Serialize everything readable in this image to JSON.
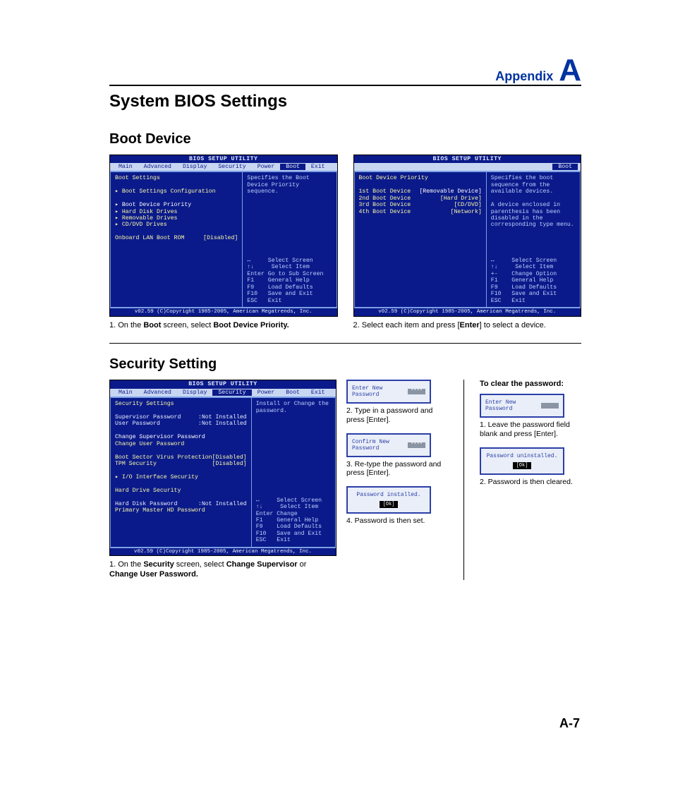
{
  "header": {
    "appendix": "Appendix",
    "letter": "A"
  },
  "page_title": "System BIOS Settings",
  "section_boot": "Boot Device",
  "section_security": "Security Setting",
  "page_number": "A-7",
  "bios_common": {
    "title": "BIOS SETUP UTILITY",
    "footer": "v02.59 (C)Copyright 1985-2005, American Megatrends, Inc.",
    "menu": [
      "Main",
      "Advanced",
      "Display",
      "Security",
      "Power",
      "Boot",
      "Exit"
    ]
  },
  "boot1": {
    "heading": "Boot Settings",
    "items": [
      "▸ Boot Settings Configuration",
      "▸ Boot Device Priority",
      "▸ Hard Disk Drives",
      "▸ Removable Drives",
      "▸ CD/DVD Drives"
    ],
    "lan_label": "Onboard LAN Boot ROM",
    "lan_value": "[Disabled]",
    "help": "Specifies the Boot Device Priority sequence.",
    "hints": [
      "↔     Select Screen",
      "↑↓     Select Item",
      "Enter Go to Sub Screen",
      "F1    General Help",
      "F9    Load Defaults",
      "F10   Save and Exit",
      "ESC   Exit"
    ]
  },
  "boot2": {
    "heading": "Boot Device Priority",
    "rows": [
      {
        "k": "1st Boot Device",
        "v": "[Removable Device]"
      },
      {
        "k": "2nd Boot Device",
        "v": "[Hard Drive]"
      },
      {
        "k": "3rd Boot Device",
        "v": "[CD/DVD]"
      },
      {
        "k": "4th Boot Device",
        "v": "[Network]"
      }
    ],
    "help": "Specifies the boot sequence from the available devices.\n\nA device enclosed in parenthesis has been disabled in the corresponding type menu.",
    "hints": [
      "↔     Select Screen",
      "↑↓     Select Item",
      "+-    Change Option",
      "F1    General Help",
      "F9    Load Defaults",
      "F10   Save and Exit",
      "ESC   Exit"
    ]
  },
  "cap_boot1_a": "1. On the ",
  "cap_boot1_b": "Boot",
  "cap_boot1_c": " screen, select ",
  "cap_boot1_d": "Boot Device Priority.",
  "cap_boot2_a": "2. Select each item and press [",
  "cap_boot2_b": "Enter",
  "cap_boot2_c": "] to select a device.",
  "sec1": {
    "heading": "Security Settings",
    "rows1": [
      {
        "k": "Supervisor Password",
        "v": ":Not Installed"
      },
      {
        "k": "User Password",
        "v": ":Not Installed"
      }
    ],
    "rows2": [
      "Change Supervisor Password",
      "Change User Password"
    ],
    "rows3": [
      {
        "k": "Boot Sector Virus Protection",
        "v": "[Disabled]"
      },
      {
        "k": "TPM Security",
        "v": "[Disabled]"
      }
    ],
    "io": "▸ I/O Interface Security",
    "hd_heading": "Hard Drive Security",
    "rows4": [
      {
        "k": "Hard Disk Password",
        "v": ":Not Installed"
      }
    ],
    "primary": "Primary Master HD Password",
    "help": "Install or Change the password.",
    "hints": [
      "↔     Select Screen",
      "↑↓     Select Item",
      "Enter Change",
      "F1    General Help",
      "F9    Load Defaults",
      "F10   Save and Exit",
      "ESC   Exit"
    ]
  },
  "cap_sec1_a": "1. On the ",
  "cap_sec1_b": "Security",
  "cap_sec1_c": " screen, select ",
  "cap_sec1_d": "Change Supervisor",
  "cap_sec1_e": " or ",
  "cap_sec1_f": "Change User Password.",
  "mid": {
    "d1": "Enter New Password",
    "d1_cap_a": "2. Type in a password and press [",
    "d1_cap_b": "Enter",
    "d1_cap_c": "].",
    "d2": "Confirm New Password",
    "d2_cap_a": "3. Re-type the password and press [",
    "d2_cap_b": "Enter",
    "d2_cap_c": "].",
    "d3": "Password installed.",
    "d3_ok": "[Ok]",
    "d3_cap": "4. Password is then set."
  },
  "right": {
    "heading": "To clear the password:",
    "d1": "Enter New Password",
    "d1_cap_a": "1. Leave the password field blank and press [",
    "d1_cap_b": "Enter",
    "d1_cap_c": "].",
    "d2": "Password uninstalled.",
    "d2_ok": "[Ok]",
    "d2_cap": "2. Password is then cleared."
  }
}
